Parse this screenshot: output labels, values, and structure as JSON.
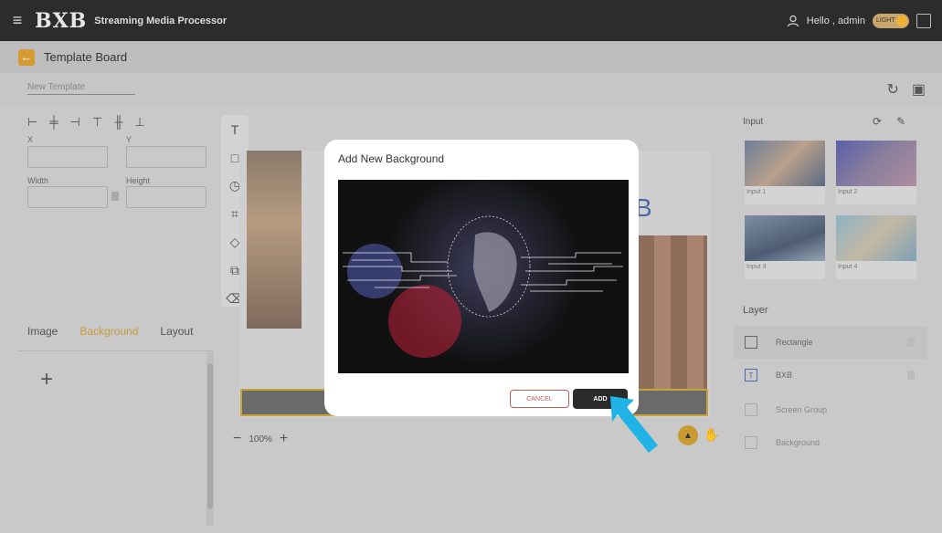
{
  "topbar": {
    "logo": "BXB",
    "app_title": "Streaming Media Processor",
    "greeting": "Hello , admin",
    "toggle_label": "LIGHT"
  },
  "header": {
    "title": "Template Board"
  },
  "template": {
    "name_placeholder": "New Template"
  },
  "transform": {
    "x_label": "X",
    "y_label": "Y",
    "width_label": "Width",
    "height_label": "Height"
  },
  "left_tabs": [
    "Image",
    "Background",
    "Layout"
  ],
  "canvas": {
    "zoom": "100%",
    "text": "B"
  },
  "input_panel": {
    "title": "Input",
    "items": [
      "Input 1",
      "Input 2",
      "Input 3",
      "Input 4"
    ]
  },
  "layer_panel": {
    "title": "Layer",
    "items": [
      "Rectangle",
      "BXB",
      "Screen Group",
      "Background"
    ]
  },
  "modal": {
    "title": "Add New Background",
    "cancel_label": "CANCEL",
    "add_label": "ADD"
  },
  "colors": {
    "accent": "#d49b32",
    "topbar": "#2c2c2c",
    "arrow": "#1fb3e6"
  }
}
